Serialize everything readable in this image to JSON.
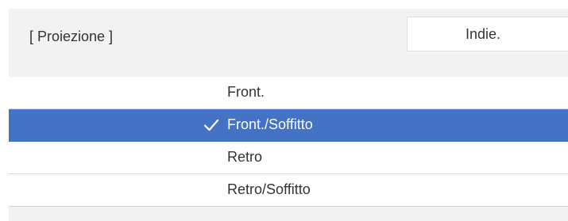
{
  "header": {
    "title": "[ Proiezione ]",
    "back_label": "Indie."
  },
  "options": [
    {
      "label": "Front.",
      "selected": false
    },
    {
      "label": "Front./Soffitto",
      "selected": true
    },
    {
      "label": "Retro",
      "selected": false
    },
    {
      "label": "Retro/Soffitto",
      "selected": false
    }
  ],
  "colors": {
    "accent": "#4472c4",
    "panel_background": "#f2f2f2",
    "text": "#333333"
  },
  "icons": {
    "selected_marker": "checkmark-icon"
  }
}
